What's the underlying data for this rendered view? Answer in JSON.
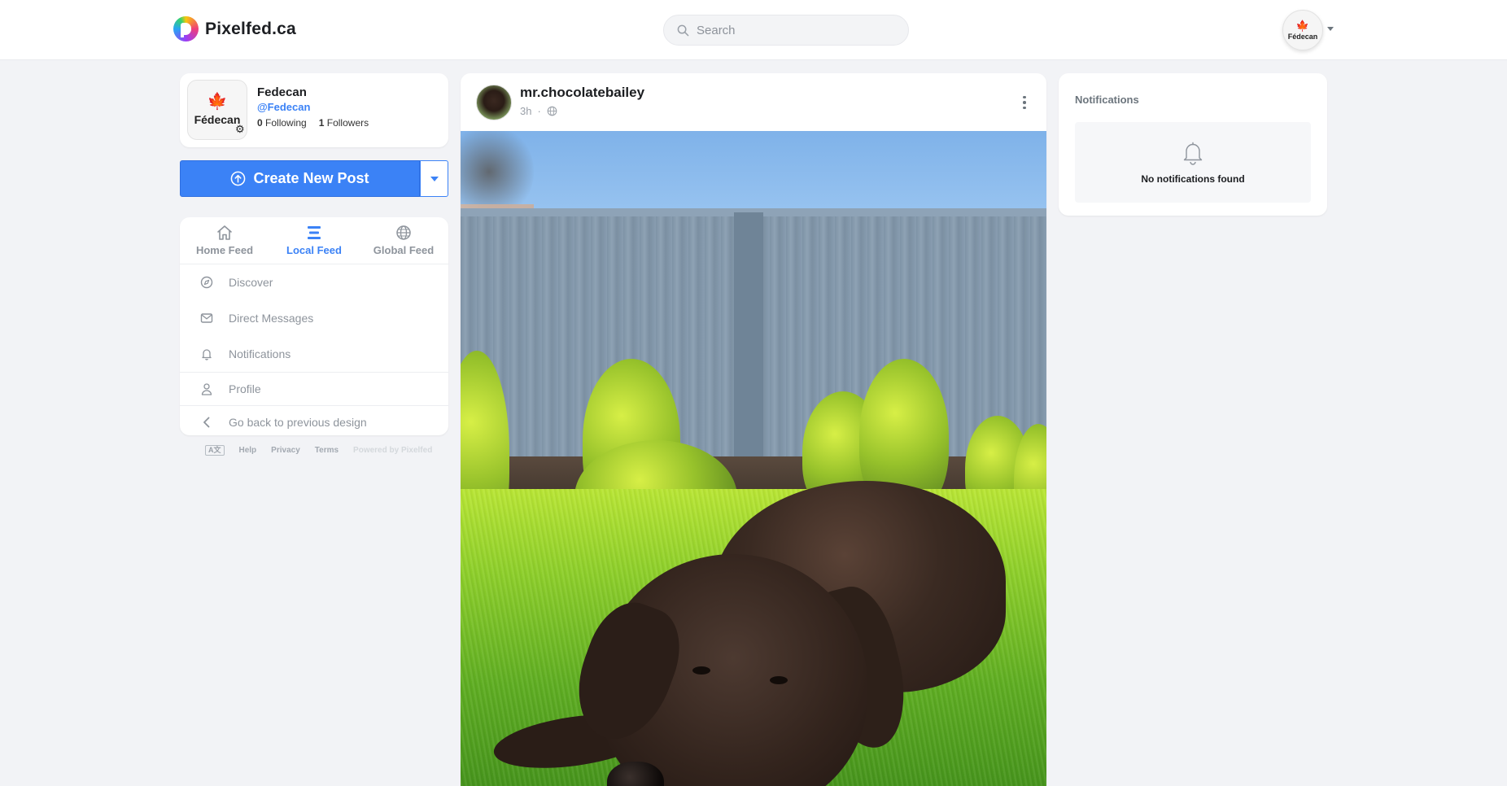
{
  "brand": {
    "name": "Pixelfed.ca"
  },
  "search": {
    "placeholder": "Search"
  },
  "nav_avatar": {
    "label": "Fédecan"
  },
  "profile": {
    "avatar_label": "Fédecan",
    "name": "Fedecan",
    "handle": "@Fedecan",
    "following_count": "0",
    "following_label": "Following",
    "followers_count": "1",
    "followers_label": "Followers"
  },
  "create_post": {
    "label": "Create New Post"
  },
  "feed_tabs": [
    {
      "label": "Home Feed",
      "icon": "home-icon",
      "active": false
    },
    {
      "label": "Local Feed",
      "icon": "list-icon",
      "active": true
    },
    {
      "label": "Global Feed",
      "icon": "globe-icon",
      "active": false
    }
  ],
  "nav_items": [
    {
      "label": "Discover",
      "icon": "compass-icon"
    },
    {
      "label": "Direct Messages",
      "icon": "envelope-icon"
    },
    {
      "label": "Notifications",
      "icon": "bell-icon"
    },
    {
      "label": "Profile",
      "icon": "user-icon"
    },
    {
      "label": "Go back to previous design",
      "icon": "chevron-left-icon"
    }
  ],
  "footer": {
    "lang": "A文",
    "help": "Help",
    "privacy": "Privacy",
    "terms": "Terms",
    "powered": "Powered by Pixelfed"
  },
  "post": {
    "username": "mr.chocolatebailey",
    "time": "3h",
    "separator": "·",
    "visibility_icon": "globe-icon"
  },
  "notifications": {
    "title": "Notifications",
    "empty_message": "No notifications found"
  },
  "colors": {
    "accent": "#3b82f6",
    "background": "#f2f3f6",
    "muted_text": "#8e949c"
  }
}
